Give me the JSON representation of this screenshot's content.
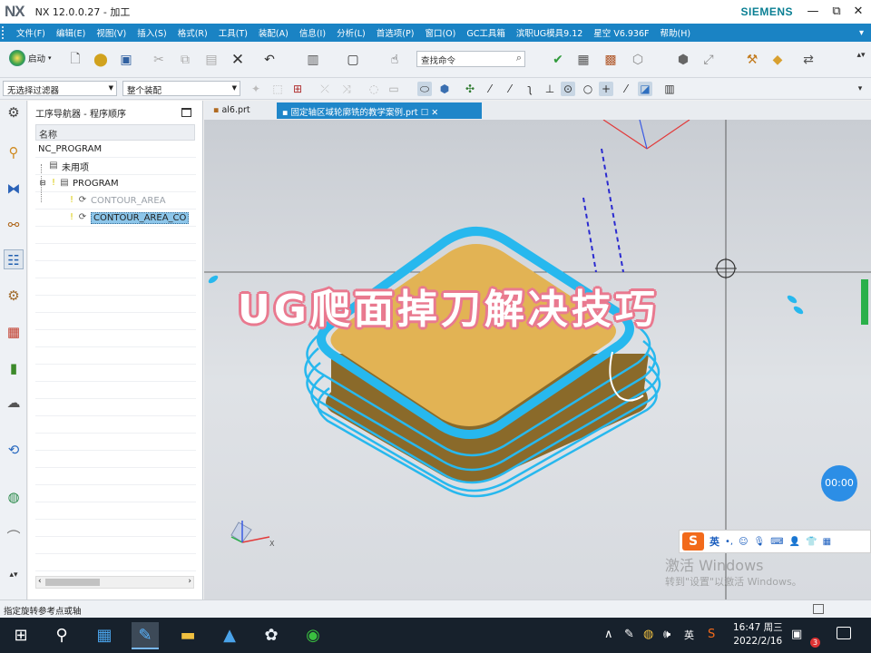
{
  "window": {
    "logo": "NX",
    "title": "NX 12.0.0.27 - 加工",
    "brand": "SIEMENS",
    "controls": {
      "minimize": "—",
      "restore": "⧉",
      "close": "✕"
    }
  },
  "menubar": {
    "items": [
      "文件(F)",
      "编辑(E)",
      "视图(V)",
      "插入(S)",
      "格式(R)",
      "工具(T)",
      "装配(A)",
      "信息(I)",
      "分析(L)",
      "首选项(P)",
      "窗口(O)",
      "GC工具箱",
      "滨职UG模具9.12",
      "星空 V6.936F",
      "帮助(H)"
    ],
    "more": "▾"
  },
  "toolbar": {
    "start_label": "启动",
    "command_search_placeholder": "查找命令"
  },
  "selection_bar": {
    "filter_value": "无选择过滤器",
    "scope_value": "整个装配"
  },
  "navigator": {
    "title": "工序导航器 - 程序顺序",
    "column_header": "名称",
    "rows": [
      {
        "label": "NC_PROGRAM",
        "state": "normal"
      },
      {
        "label": "未用项",
        "state": "normal"
      },
      {
        "label": "PROGRAM",
        "state": "normal"
      },
      {
        "label": "CONTOUR_AREA",
        "state": "dimmed"
      },
      {
        "label": "CONTOUR_AREA_CO",
        "state": "selected"
      }
    ]
  },
  "tabs": [
    {
      "label": "al6.prt",
      "active": false
    },
    {
      "label": "固定轴区域轮廓铣的教学案例.prt",
      "active": true
    }
  ],
  "viewport": {
    "overlay_text": "UG爬面掉刀解决技巧",
    "timer": "00:00",
    "axis_label": "X"
  },
  "ime_bar": {
    "logo": "S",
    "mode": "英"
  },
  "watermark": {
    "line1": "激活 Windows",
    "line2": "转到\"设置\"以激活 Windows。"
  },
  "statusbar": {
    "message": "指定旋转参考点或轴"
  },
  "taskbar": {
    "tray_lang": "英",
    "time": "16:47 周三",
    "date": "2022/2/16",
    "notification_count": "3"
  },
  "colors": {
    "menubar": "#1a83c4",
    "active_tab": "#1f86c9",
    "toolpath": "#27b8ee",
    "part_top": "#e2b354",
    "part_side": "#8a6a2a",
    "taskbar": "#17212c"
  }
}
